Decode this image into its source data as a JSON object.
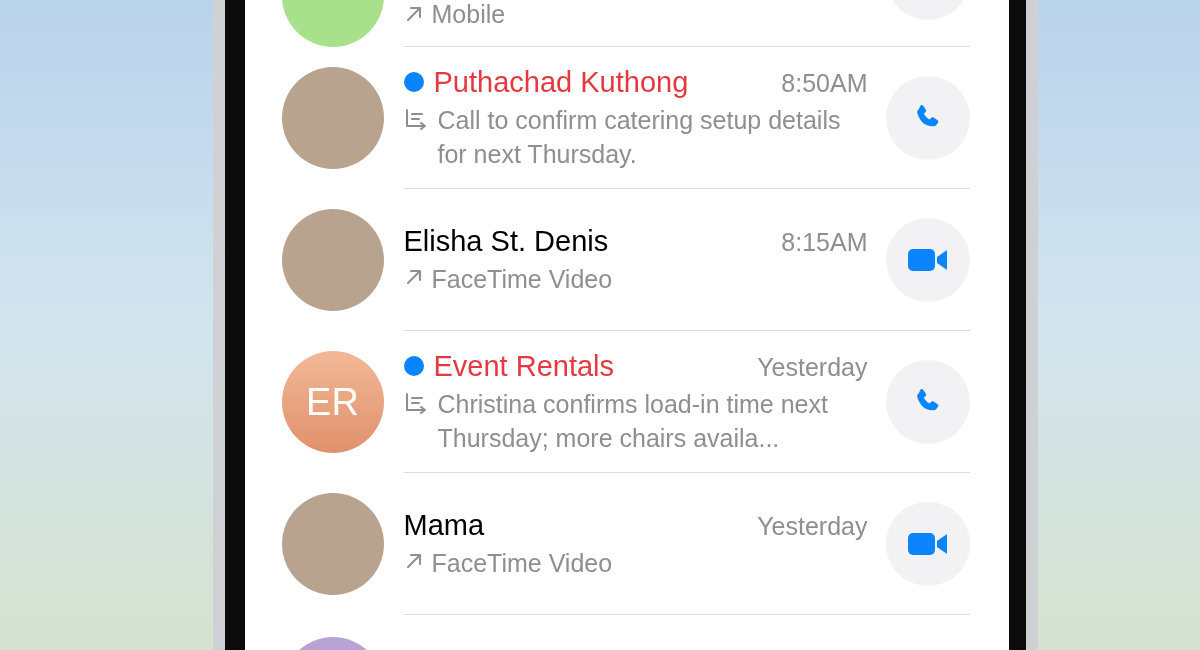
{
  "top_row": {
    "detail": {
      "kind": "outgoing",
      "text": "Mobile"
    }
  },
  "calls": [
    {
      "name": "Puthachad Kuthong",
      "unread": true,
      "time": "8:50AM",
      "detail": {
        "kind": "transcript",
        "text": "Call to confirm catering setup details for next Thursday."
      },
      "avatar": {
        "kind": "photo"
      },
      "button": {
        "kind": "audio"
      }
    },
    {
      "name": "Elisha St. Denis",
      "unread": false,
      "time": "8:15AM",
      "detail": {
        "kind": "outgoing",
        "text": "FaceTime Video"
      },
      "avatar": {
        "kind": "photo"
      },
      "button": {
        "kind": "video"
      }
    },
    {
      "name": "Event Rentals",
      "unread": true,
      "time": "Yesterday",
      "detail": {
        "kind": "transcript",
        "text": "Christina confirms load-in time next Thursday; more chairs availa..."
      },
      "avatar": {
        "kind": "initials",
        "text": "ER"
      },
      "button": {
        "kind": "audio"
      }
    },
    {
      "name": "Mama",
      "unread": false,
      "time": "Yesterday",
      "detail": {
        "kind": "outgoing",
        "text": "FaceTime Video"
      },
      "avatar": {
        "kind": "photo"
      },
      "button": {
        "kind": "video"
      }
    }
  ]
}
